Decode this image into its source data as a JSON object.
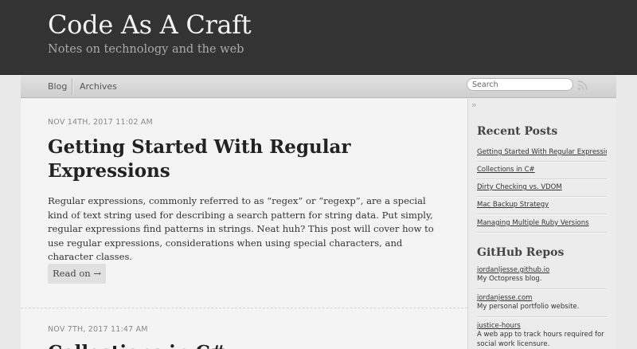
{
  "header": {
    "title": "Code As A Craft",
    "subtitle": "Notes on technology and the web"
  },
  "nav": {
    "items": [
      {
        "label": "Blog"
      },
      {
        "label": "Archives"
      }
    ],
    "search_placeholder": "Search",
    "rss_icon": "rss-icon"
  },
  "posts": [
    {
      "date": "NOV 14TH, 2017 11:02 AM",
      "title": "Getting Started With Regular Expressions",
      "excerpt": "Regular expressions, commonly referred to as “regex” or “regexp”, are a special kind of text string used for describing a search pattern for string data. Put simply, regular expressions find patterns in strings. Neat huh? This post will cover how to use regular expressions, considerations when using special characters, and character classes.",
      "read_on": "Read on →"
    },
    {
      "date": "NOV 7TH, 2017 11:47 AM",
      "title": "Collections in C#"
    }
  ],
  "sidebar": {
    "collapse_icon": "»",
    "recent_heading": "Recent Posts",
    "recent_posts": [
      "Getting Started With Regular Expressions",
      "Collections in C#",
      "Dirty Checking vs. VDOM",
      "Mac Backup Strategy",
      "Managing Multiple Ruby Versions"
    ],
    "github_heading": "GitHub Repos",
    "repos": [
      {
        "name": "jordanljesse.github.io",
        "description": "My Octopress blog."
      },
      {
        "name": "jordanjesse.com",
        "description": "My personal portfolio website."
      },
      {
        "name": "justice-hours",
        "description": "A web app to track hours required for social work licensure."
      }
    ]
  },
  "colors": {
    "header_bg": "#333333",
    "page_bg": "#f4f4f4",
    "sidebar_bg": "#ececec"
  }
}
